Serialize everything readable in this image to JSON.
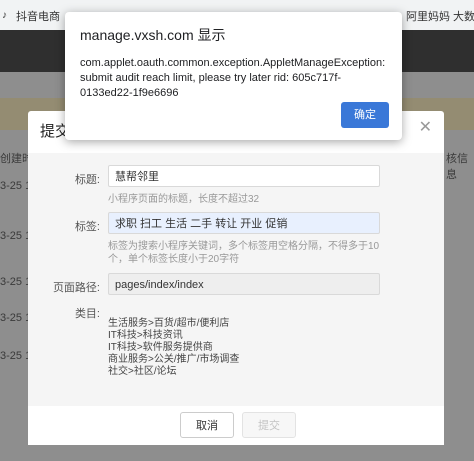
{
  "bookmarks": {
    "left": "抖音电商",
    "right": "阿里妈妈 大数据"
  },
  "background_page": {
    "dates": [
      "3-25 1",
      "3-25 1",
      "3-25 1",
      "3-25 1",
      "3-25 1"
    ],
    "col_left": "创建时",
    "col_right": "核信息"
  },
  "dialog": {
    "title": "提交",
    "close_icon": "close-icon",
    "title_label": "标题:",
    "title_value": "慧帮邻里",
    "title_hint": "小程序页面的标题，长度不超过32",
    "tags_label": "标签:",
    "tags_value": "求职 扫工 生活 二手 转让 开业 促销",
    "tags_hint": "标签为搜索小程序关键词，多个标签用空格分隔，不得多于10个，单个标签长度小于20字符",
    "path_label": "页面路径:",
    "path_value": "pages/index/index",
    "category_label": "类目:",
    "categories": [
      "生活服务>百货/超市/便利店",
      "IT科技>科技资讯",
      "IT科技>软件服务提供商",
      "商业服务>公关/推广/市场调查",
      "社交>社区/论坛"
    ],
    "cancel_label": "取消",
    "submit_label": "提交"
  },
  "alert": {
    "title": "manage.vxsh.com 显示",
    "message": "com.applet.oauth.common.exception.AppletManageException: submit audit reach limit, please try later rid: 605c717f-0133ed22-1f9e6696",
    "ok_label": "确定",
    "ok_color": "#3a78d8"
  }
}
